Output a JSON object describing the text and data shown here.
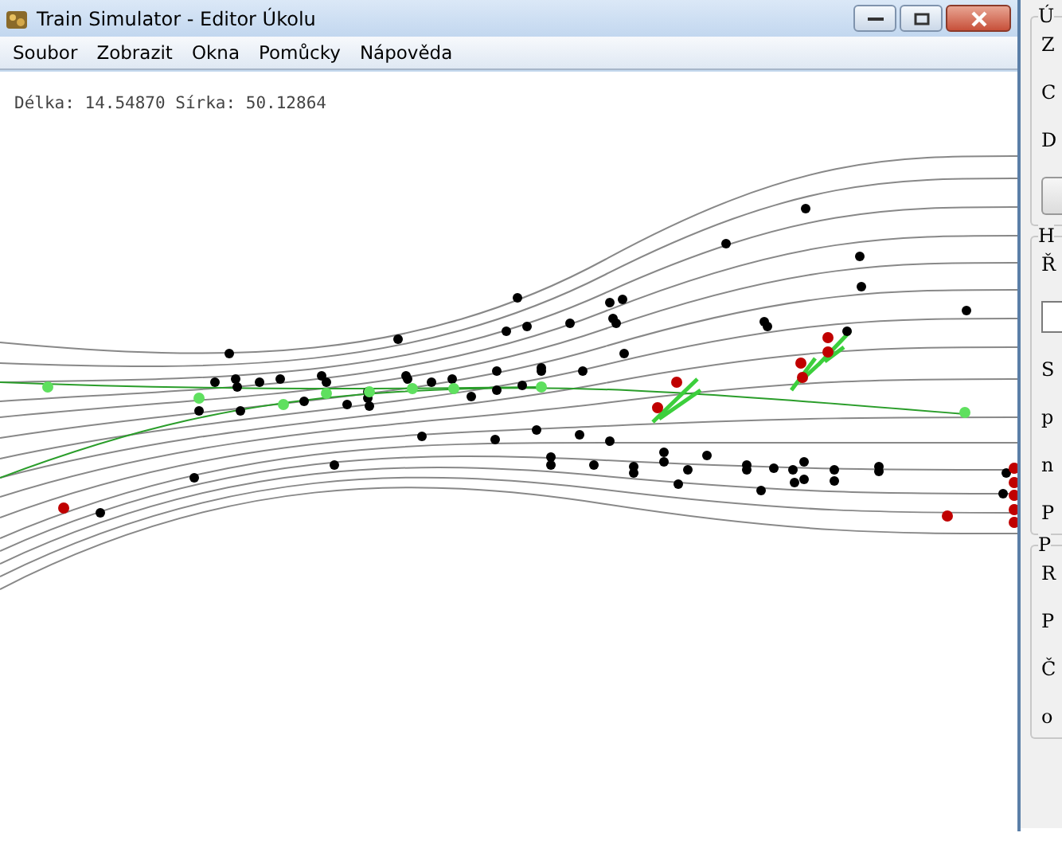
{
  "window": {
    "title": "Train Simulator - Editor Úkolu"
  },
  "menu": [
    "Soubor",
    "Zobrazit",
    "Okna",
    "Pomůcky",
    "Nápověda"
  ],
  "map": {
    "coordinates": "Délka: 14.54870 Sírka: 50.12864"
  },
  "side_panel": {
    "groups": [
      {
        "title": "Ú",
        "lines": [
          "Z",
          "C",
          "D"
        ],
        "has_button": true
      },
      {
        "title": "H",
        "lines": [
          "Ř",
          "S",
          "p",
          "n",
          "P"
        ],
        "has_field": true
      },
      {
        "title": "P",
        "lines": [
          "R",
          "P",
          "Č",
          "o"
        ]
      }
    ]
  }
}
